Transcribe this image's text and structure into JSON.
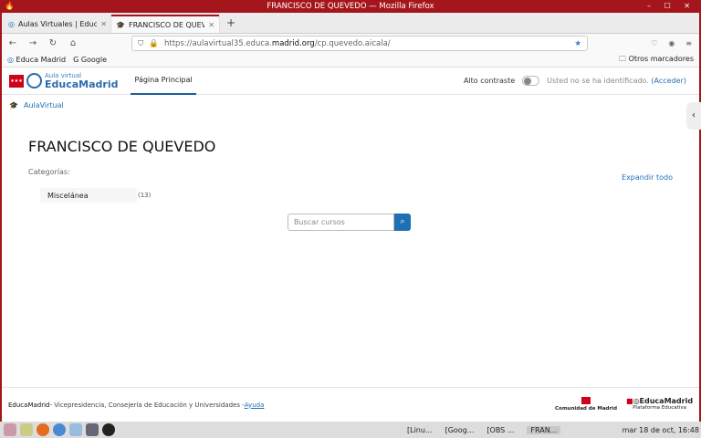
{
  "window": {
    "title": "FRANCISCO DE QUEVEDO — Mozilla Firefox"
  },
  "tabs": [
    {
      "label": "Aulas Virtuales | EducaMadrid"
    },
    {
      "label": "FRANCISCO DE QUEVEDO"
    }
  ],
  "address": {
    "pre": "https://aulavirtual35.educa.",
    "domain": "madrid.org",
    "path": "/cp.quevedo.aicala/"
  },
  "bookmarks": [
    {
      "label": "Educa Madrid"
    },
    {
      "label": "Google"
    }
  ],
  "other_bookmarks": "Otros marcadores",
  "header": {
    "logo_small": "Aula virtual",
    "logo_big": "EducaMadrid",
    "nav": "Página Principal",
    "contrast": "Alto contraste",
    "contrast_on": false,
    "not_logged": "Usted no se ha identificado.",
    "login": "(Acceder)"
  },
  "breadcrumb": "AulaVirtual",
  "page": {
    "title": "FRANCISCO DE QUEVEDO",
    "categories_label": "Categorías:",
    "expand": "Expandir todo",
    "category": {
      "name": "Miscelánea",
      "count": "(13)"
    },
    "search_placeholder": "Buscar cursos"
  },
  "footer": {
    "brand": "EducaMadrid",
    "text": " - Vicepresidencia, Consejería de Educación y Universidades - ",
    "help": "Ayuda",
    "logo1": "Comunidad de Madrid",
    "logo2": "EducaMadrid",
    "logo2_sub": "Plataforma Educativa"
  },
  "taskbar": {
    "tasks": [
      "[Linu...",
      "[Goog...",
      "[OBS ...",
      "FRAN..."
    ],
    "clock": "mar 18 de oct, 16:48"
  },
  "colors": {
    "accent": "#1f6fb5",
    "frame": "#a5161c"
  }
}
